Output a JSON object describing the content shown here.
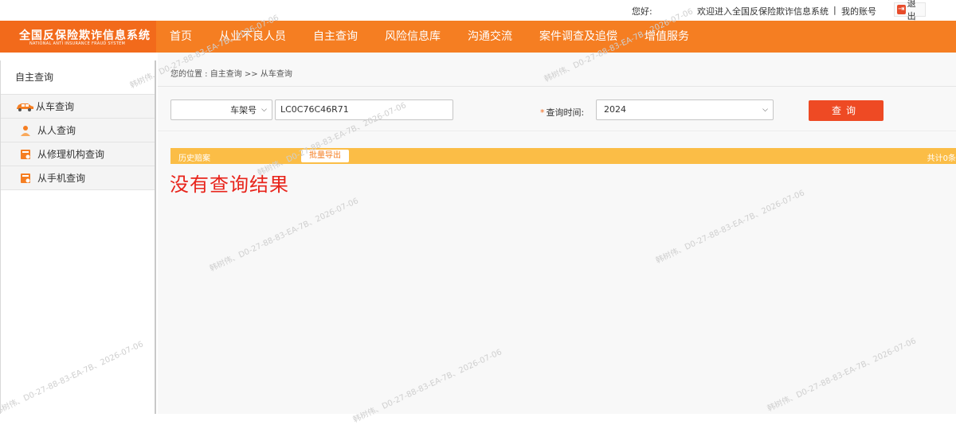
{
  "topbar": {
    "greeting": "您好:",
    "welcome": "欢迎进入全国反保险欺诈信息系统",
    "separator": "|",
    "account": "我的账号",
    "logout": "退出"
  },
  "brand": {
    "title_cn": "全国反保险欺诈信息系统",
    "title_en": "NATIONAL ANTI INSURANCE FRAUD SYSTEM"
  },
  "nav": {
    "items": [
      "首页",
      "从业不良人员",
      "自主查询",
      "风险信息库",
      "沟通交流",
      "案件调查及追偿",
      "增值服务"
    ]
  },
  "sidebar": {
    "header": "自主查询",
    "items": [
      {
        "label": "从车查询",
        "icon": "car-icon"
      },
      {
        "label": "从人查询",
        "icon": "person-icon"
      },
      {
        "label": "从修理机构查询",
        "icon": "repair-shop-icon"
      },
      {
        "label": "从手机查询",
        "icon": "phone-icon"
      }
    ]
  },
  "main": {
    "breadcrumb": "您的位置 : 自主查询 >> 从车查询",
    "type_select": "车架号",
    "vin_value": "LC0C76C46R71",
    "query_time_label": "查询时间:",
    "required_mark": "*",
    "year_select": "2024",
    "query_button": "查询",
    "history_title": "历史赔案",
    "export_button": "批量导出",
    "total_text": "共计0条",
    "no_result": "没有查询结果"
  },
  "watermark": {
    "texts": [
      "韩树伟、D0-27-88-83-EA-7B、2026-07-06",
      "韩树伟、D0-27-88-83-EA-7B、2026-07-06",
      "韩树伟、D0-27-88-83-EA-7B、2026-07-06",
      "韩树伟、D0-27-88-83-EA-7B、2026-07-06",
      "韩树伟、D0-27-88-83-EA-7B、2026-07-06",
      "韩树伟、D0-27-88-83-EA-7B、2026-07-06",
      "韩树伟、D0-27-88-83-EA-7B、2026-07-06",
      "韩树伟、D0-27-88-83-EA-7B、2026-07-06"
    ]
  },
  "colors": {
    "nav": "#f57e22",
    "brand": "#f26a1b",
    "history_bar": "#fbbd46",
    "query_button": "#ee4a24",
    "no_result": "#e8231a"
  }
}
